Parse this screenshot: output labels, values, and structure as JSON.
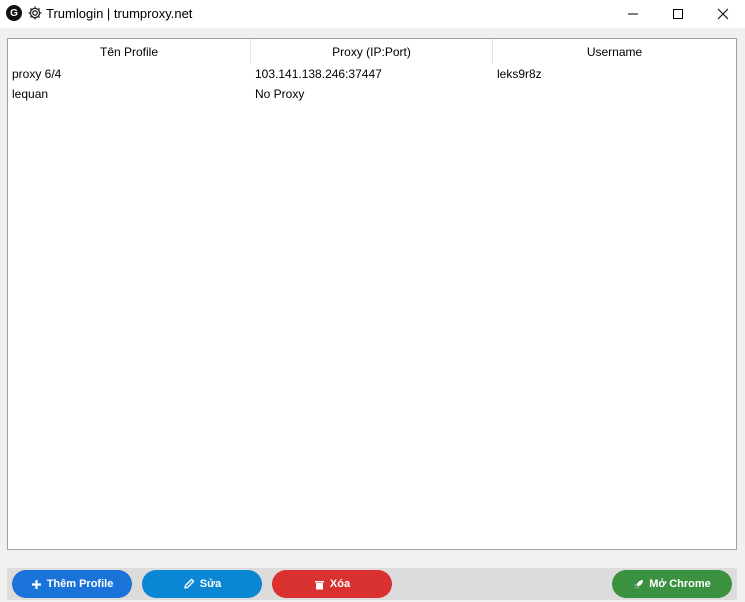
{
  "window": {
    "app_icon_letter": "G",
    "title": "Trumlogin | trumproxy.net"
  },
  "table": {
    "columns": [
      "Tên Profile",
      "Proxy (IP:Port)",
      "Username"
    ],
    "rows": [
      [
        "proxy 6/4",
        "103.141.138.246:37447",
        "leks9r8z"
      ],
      [
        "lequan",
        "No Proxy",
        ""
      ]
    ]
  },
  "toolbar": {
    "add_label": "Thêm Profile",
    "edit_label": "Sửa",
    "delete_label": "Xóa",
    "chrome_label": "Mở Chrome"
  },
  "icons": {
    "add": "plus-icon",
    "edit": "pencil-icon",
    "delete": "trash-icon",
    "chrome": "rocket-icon"
  },
  "colors": {
    "add": "#1a73d9",
    "edit": "#0a86d2",
    "delete": "#d93030",
    "chrome": "#3a9140"
  }
}
